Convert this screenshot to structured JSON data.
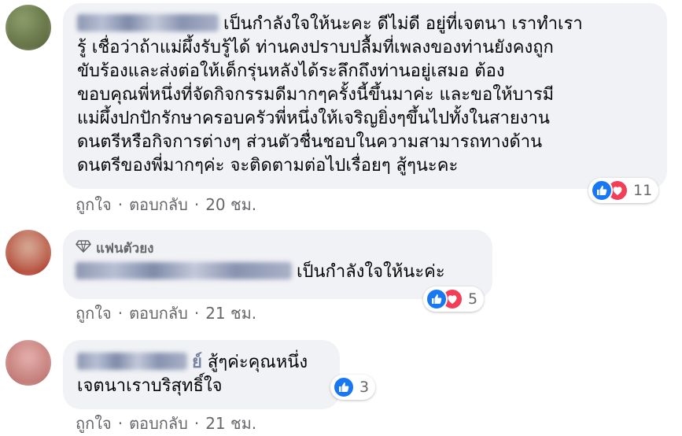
{
  "comments": [
    {
      "author": "",
      "text_lines": [
        "เป็นกำลังใจให้นะคะ ดีไม่ดี อยู่ที่เจตนา เราทำเรา",
        "รู้ เชื่อว่าถ้าแม่ผึ้งรับรู้ได้ ท่านคงปราบปลื้มที่เพลงของท่านยังคงถูก",
        "ขับร้องและส่งต่อให้เด็กรุ่นหลังได้ระลึกถึงท่านอยู่เสมอ ต้อง",
        "ขอบคุณพี่หนึ่งที่จัดกิจกรรมดีมากๆครั้งนี้ขึ้นมาค่ะ และขอให้บารมี",
        "แม่ผึ้งปกปักรักษาครอบครัวพี่หนึ่งให้เจริญยิ่งๆขึ้นไปทั้งในสายงาน",
        "ดนตรีหรือกิจการต่างๆ ส่วนตัวชื่นชอบในความสามารถทางด้าน",
        "ดนตรีของพี่มากๆค่ะ จะติดตามต่อไปเรื่อยๆ สู้ๆนะคะ"
      ],
      "reaction_count": "11",
      "reactions": [
        "like-icon",
        "love-icon"
      ],
      "like_label": "ถูกใจ",
      "reply_label": "ตอบกลับ",
      "time": "20 ชม."
    },
    {
      "badge": "แฟนตัวยง",
      "author": "",
      "text_lines": [
        "เป็นกำลังใจให้นะค่ะ"
      ],
      "reaction_count": "5",
      "reactions": [
        "like-icon",
        "love-icon"
      ],
      "like_label": "ถูกใจ",
      "reply_label": "ตอบกลับ",
      "time": "21 ชม."
    },
    {
      "author": "ย์",
      "text_lines": [
        "สู้ๆค่ะคุณหนึ่ง",
        "เจตนาเราบริสุทธิ์ใจ"
      ],
      "reaction_count": "3",
      "reactions": [
        "like-icon"
      ],
      "like_label": "ถูกใจ",
      "reply_label": "ตอบกลับ",
      "time": "21 ชม."
    }
  ],
  "colors": {
    "bubble": "#f0f2f5",
    "meta_text": "#65676b",
    "like": "#1877f2",
    "love": "#f33e58"
  }
}
